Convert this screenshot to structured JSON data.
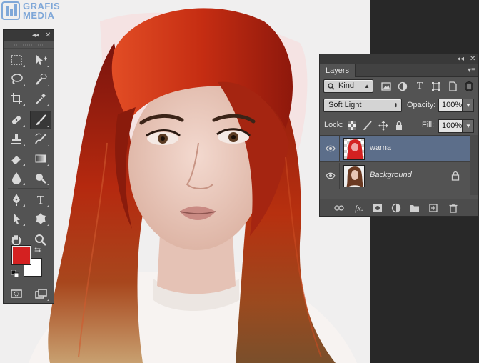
{
  "watermark": {
    "line1": "GRAFIS",
    "line2": "MEDIA"
  },
  "tools_panel": {
    "collapse_glyph": "◂◂",
    "close_glyph": "✕",
    "tools": [
      {
        "name": "rectangular-marquee-icon"
      },
      {
        "name": "move-icon"
      },
      {
        "name": "lasso-icon"
      },
      {
        "name": "quick-selection-icon"
      },
      {
        "name": "crop-icon"
      },
      {
        "name": "eyedropper-icon"
      },
      {
        "name": "spot-healing-icon"
      },
      {
        "name": "brush-icon",
        "active": true
      },
      {
        "name": "clone-stamp-icon"
      },
      {
        "name": "history-brush-icon"
      },
      {
        "name": "eraser-icon"
      },
      {
        "name": "gradient-icon"
      },
      {
        "name": "blur-icon"
      },
      {
        "name": "dodge-icon"
      },
      {
        "name": "pen-icon"
      },
      {
        "name": "type-icon"
      },
      {
        "name": "path-selection-icon"
      },
      {
        "name": "custom-shape-icon"
      },
      {
        "name": "hand-icon"
      },
      {
        "name": "zoom-icon"
      }
    ],
    "foreground_color": "#d42121",
    "background_color": "#ffffff",
    "type_glyph": "T",
    "swap_glyph": "⇆"
  },
  "layers_panel": {
    "collapse_glyph": "◂◂",
    "close_glyph": "✕",
    "tab_label": "Layers",
    "menu_glyph": "▾≡",
    "filter_kind": "Kind",
    "blend_mode": "Soft Light",
    "opacity_label": "Opacity:",
    "opacity_value": "100%",
    "lock_label": "Lock:",
    "fill_label": "Fill:",
    "fill_value": "100%",
    "type_filter_glyph": "T",
    "layers": [
      {
        "name": "warna",
        "selected": true,
        "italic": false
      },
      {
        "name": "Background",
        "selected": false,
        "italic": true,
        "locked": true
      }
    ],
    "footer_fx": "fx."
  }
}
